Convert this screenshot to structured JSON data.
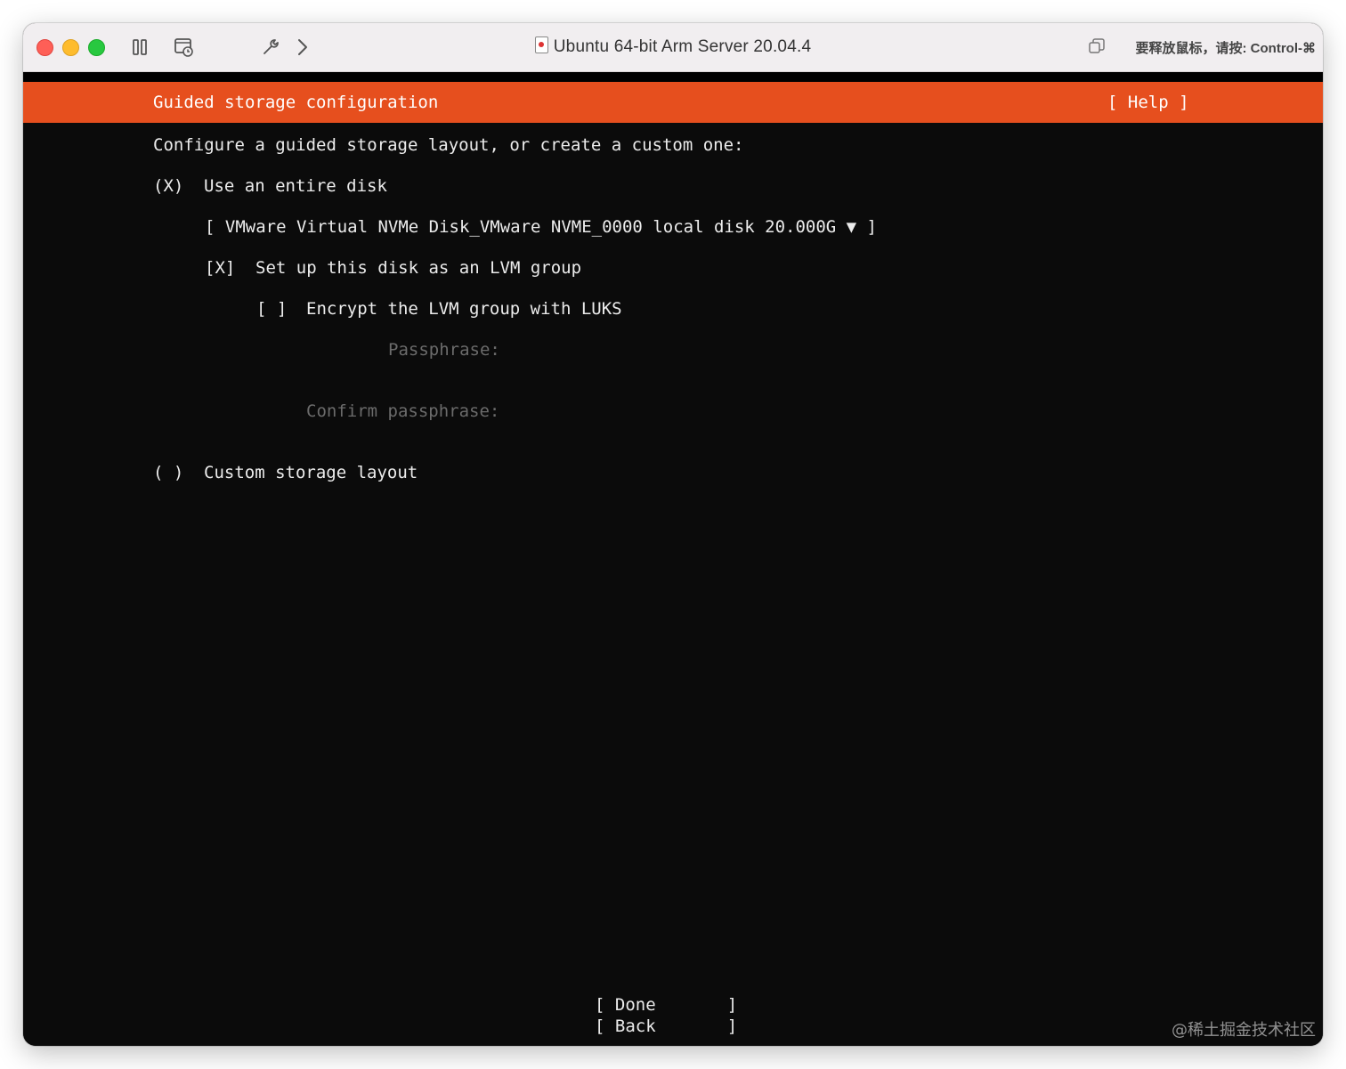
{
  "window": {
    "title": "Ubuntu 64-bit Arm Server 20.04.4",
    "release_hint": "要释放鼠标，请按: Control-⌘"
  },
  "toolbar": {
    "icons": [
      "pause-icon",
      "snapshot-icon",
      "wrench-icon",
      "chevron-right-icon",
      "restore-window-icon"
    ]
  },
  "installer": {
    "header_title": "Guided storage configuration",
    "help_label": "[ Help ]",
    "intro": "Configure a guided storage layout, or create a custom one:",
    "entire_disk_radio": "(X)",
    "entire_disk_label": "Use an entire disk",
    "disk_select": "[ VMware Virtual NVMe Disk_VMware NVME_0000 local disk 20.000G ▼ ]",
    "lvm_checkbox": "[X]",
    "lvm_label": "Set up this disk as an LVM group",
    "encrypt_checkbox": "[ ]",
    "encrypt_label": "Encrypt the LVM group with LUKS",
    "passphrase_label": "Passphrase:",
    "confirm_label": "Confirm passphrase:",
    "custom_radio": "( )",
    "custom_label": "Custom storage layout",
    "done_button": "[ Done       ]",
    "back_button": "[ Back       ]"
  },
  "watermark": "@稀土掘金技术社区",
  "colors": {
    "accent": "#e64f1e",
    "terminal_bg": "#0b0b0b",
    "text": "#ececec",
    "dim_text": "#6b6b6b"
  }
}
